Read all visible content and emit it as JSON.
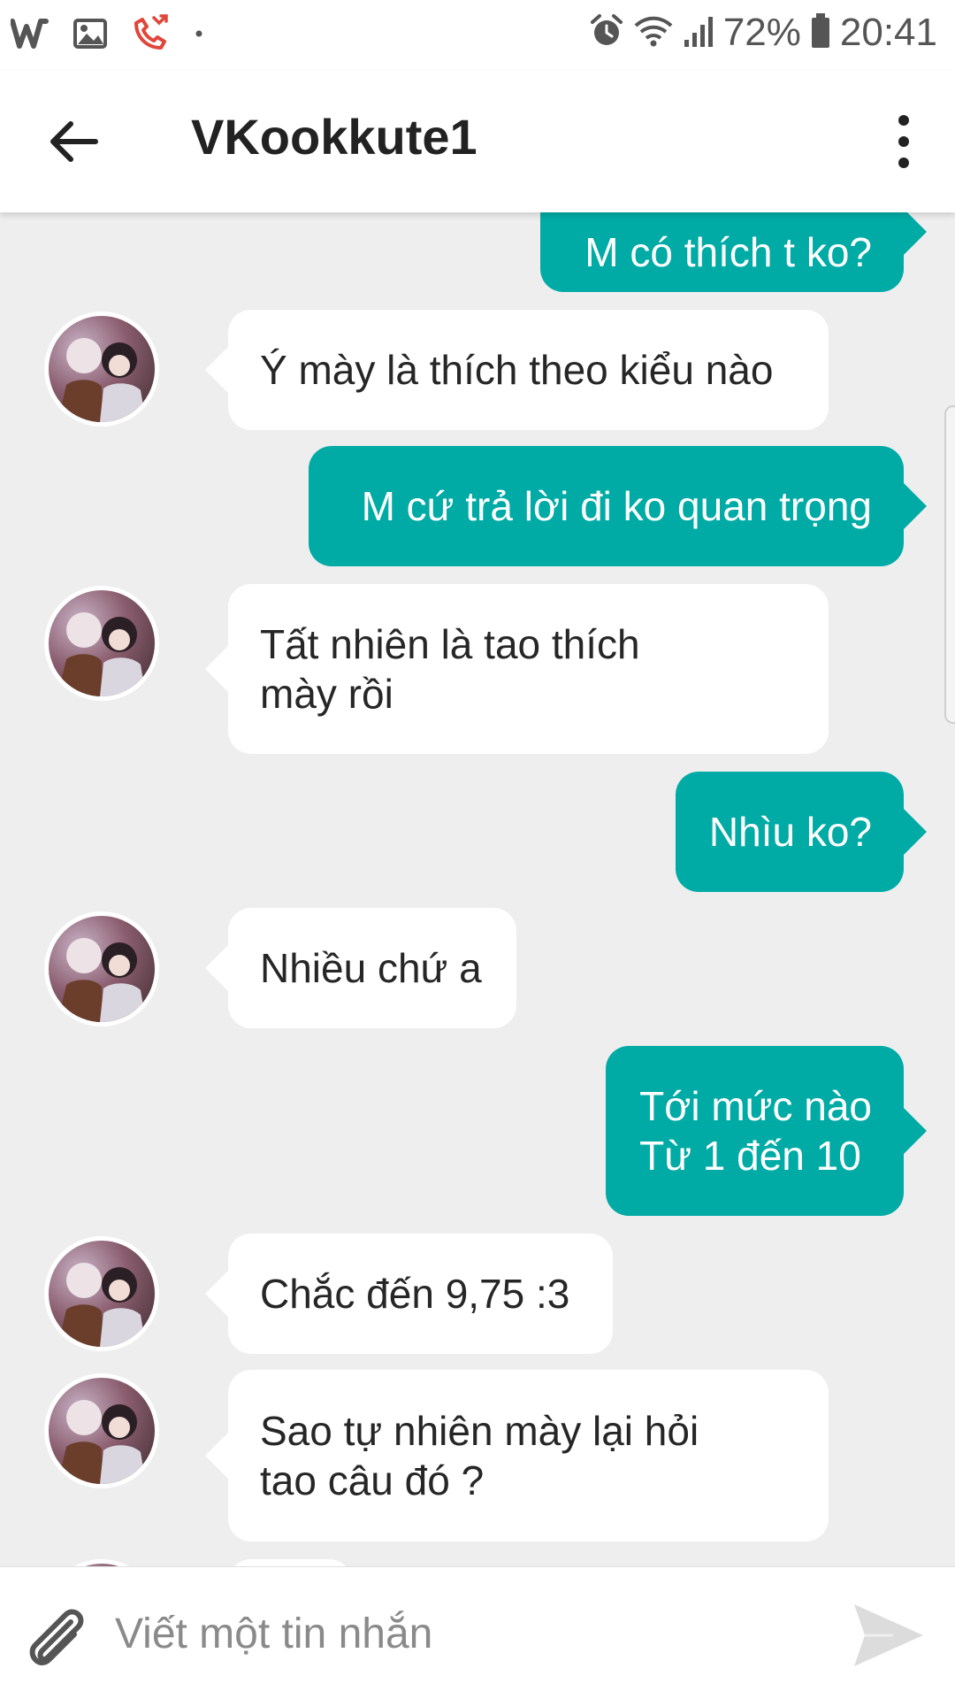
{
  "status_bar": {
    "battery": "72%",
    "time": "20:41"
  },
  "header": {
    "title": "VKookkute1"
  },
  "messages": [
    {
      "side": "out",
      "text": "M có thích t ko?"
    },
    {
      "side": "in",
      "text": "Ý mày là thích theo kiểu nào"
    },
    {
      "side": "out",
      "text": "M cứ trả lời đi ko quan trọng"
    },
    {
      "side": "in",
      "text": "Tất nhiên là tao thích\nmày rồi"
    },
    {
      "side": "out",
      "text": "Nhìu ko?"
    },
    {
      "side": "in",
      "text": "Nhiều chứ a"
    },
    {
      "side": "out",
      "text": "Tới mức nào\nTừ 1 đến 10"
    },
    {
      "side": "in",
      "text": "Chắc đến 9,75 :3"
    },
    {
      "side": "in",
      "text": "Sao tự nhiên mày lại hỏi\ntao câu đó ?"
    }
  ],
  "composer": {
    "placeholder": "Viết một tin nhắn"
  },
  "colors": {
    "outgoing_bubble": "#00aba6",
    "incoming_bubble": "#ffffff",
    "background": "#eeeeee"
  },
  "icons": {
    "status_left": [
      "wattpad-icon",
      "gallery-icon",
      "missed-call-icon",
      "notification-dot-icon"
    ],
    "status_right": [
      "alarm-icon",
      "wifi-icon",
      "signal-icon",
      "battery-icon"
    ],
    "header": [
      "back-arrow-icon",
      "more-vert-icon"
    ],
    "composer": [
      "paperclip-icon",
      "send-icon"
    ]
  }
}
